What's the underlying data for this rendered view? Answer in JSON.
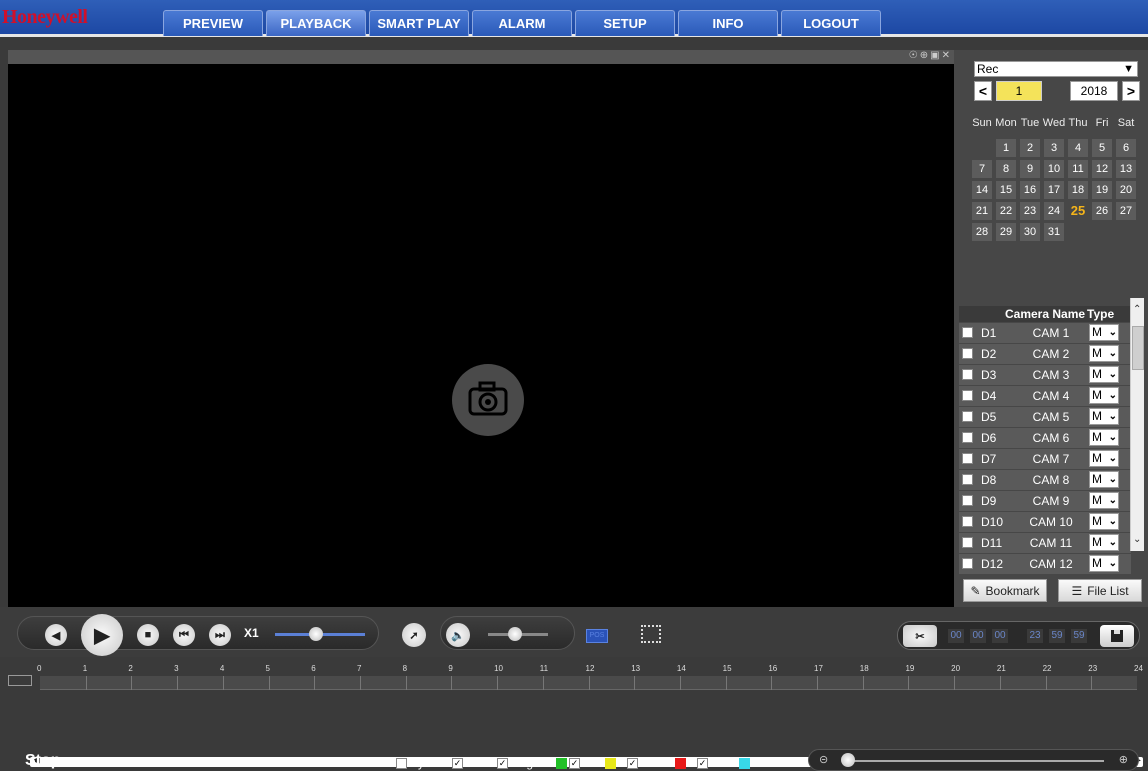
{
  "brand": "Honeywell",
  "nav": [
    "PREVIEW",
    "PLAYBACK",
    "SMART PLAY",
    "ALARM",
    "SETUP",
    "INFO",
    "LOGOUT"
  ],
  "active_tab": "PLAYBACK",
  "calendar": {
    "record_type": "Rec",
    "month": "1",
    "year": "2018",
    "prev": "<",
    "next": ">",
    "weekdays": [
      "Sun",
      "Mon",
      "Tue",
      "Wed",
      "Thu",
      "Fri",
      "Sat"
    ],
    "first_weekday_offset": 1,
    "days_in_month": 31,
    "highlighted_day": 25
  },
  "camera_table": {
    "header_name": "Camera Name",
    "header_type": "Type",
    "rows": [
      {
        "id": "D1",
        "name": "CAM 1",
        "type": "M"
      },
      {
        "id": "D2",
        "name": "CAM 2",
        "type": "M"
      },
      {
        "id": "D3",
        "name": "CAM 3",
        "type": "M"
      },
      {
        "id": "D4",
        "name": "CAM 4",
        "type": "M"
      },
      {
        "id": "D5",
        "name": "CAM 5",
        "type": "M"
      },
      {
        "id": "D6",
        "name": "CAM 6",
        "type": "M"
      },
      {
        "id": "D7",
        "name": "CAM 7",
        "type": "M"
      },
      {
        "id": "D8",
        "name": "CAM 8",
        "type": "M"
      },
      {
        "id": "D9",
        "name": "CAM 9",
        "type": "M"
      },
      {
        "id": "D10",
        "name": "CAM 10",
        "type": "M"
      },
      {
        "id": "D11",
        "name": "CAM 11",
        "type": "M"
      },
      {
        "id": "D12",
        "name": "CAM 12",
        "type": "M"
      }
    ]
  },
  "buttons": {
    "bookmark": "Bookmark",
    "file_list": "File List"
  },
  "playback": {
    "speed": "X1",
    "speed_level": 0.45,
    "volume_level": 0.45,
    "pos_label": "POS"
  },
  "clip": {
    "start": [
      "00",
      "00",
      "00"
    ],
    "end": [
      "23",
      "59",
      "59"
    ]
  },
  "timeline": {
    "hours": [
      "0",
      "1",
      "2",
      "3",
      "4",
      "5",
      "6",
      "7",
      "8",
      "9",
      "10",
      "11",
      "12",
      "13",
      "14",
      "15",
      "16",
      "17",
      "18",
      "19",
      "20",
      "21",
      "22",
      "23",
      "24"
    ]
  },
  "status": "Stop",
  "filters": [
    {
      "label": "Sync",
      "checked": false,
      "color": ""
    },
    {
      "label": "All",
      "checked": true,
      "color": ""
    },
    {
      "label": "Regular",
      "checked": true,
      "color": "#22c028"
    },
    {
      "label": "MD",
      "checked": true,
      "color": "#e8e81a"
    },
    {
      "label": "Alarm",
      "checked": true,
      "color": "#e81a1a"
    },
    {
      "label": "POS",
      "checked": true,
      "color": "#38d8e8"
    }
  ],
  "zoom_level": 0.0
}
